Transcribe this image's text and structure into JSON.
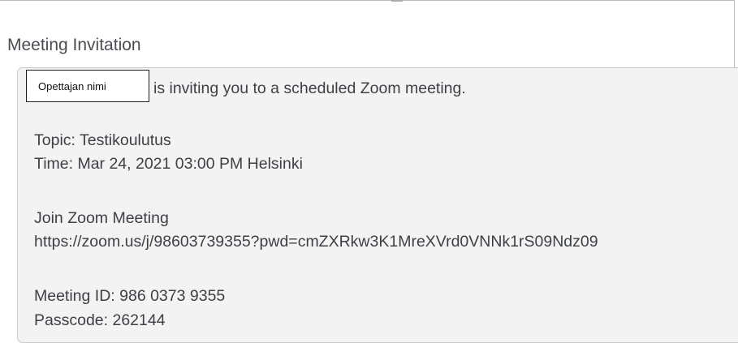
{
  "section": {
    "title": "Meeting Invitation"
  },
  "invitation": {
    "host_name": "Opettajan nimi",
    "invite_text": "is inviting you to a scheduled Zoom meeting.",
    "topic": "Topic: Testikoulutus",
    "time": "Time: Mar 24, 2021 03:00 PM Helsinki",
    "join_heading": "Join Zoom Meeting",
    "join_link": "https://zoom.us/j/98603739355?pwd=cmZXRkw3K1MreXVrd0VNNk1rS09Ndz09",
    "meeting_id": "Meeting ID: 986 0373 9355",
    "passcode": "Passcode: 262144"
  }
}
